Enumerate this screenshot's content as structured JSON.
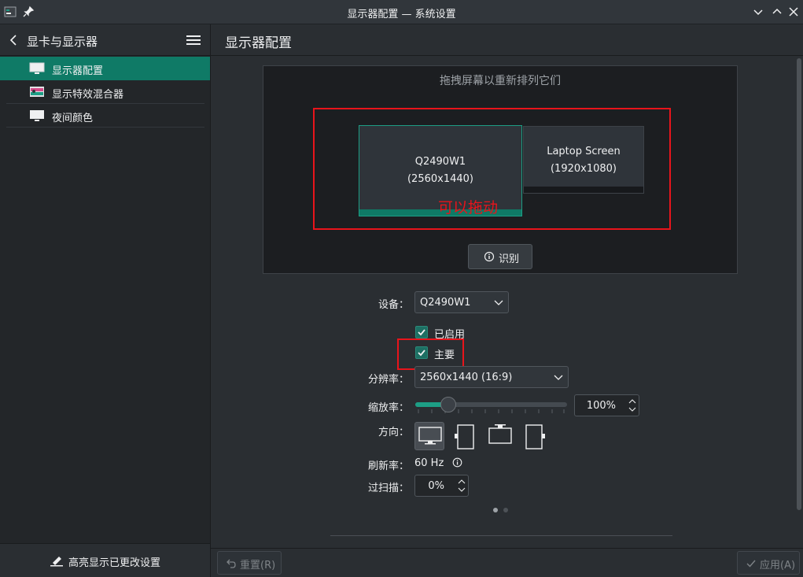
{
  "window": {
    "title": "显示器配置 — 系统设置"
  },
  "sidebar": {
    "title": "显卡与显示器",
    "items": [
      {
        "label": "显示器配置",
        "icon": "monitor-icon",
        "active": true
      },
      {
        "label": "显示特效混合器",
        "icon": "compositor-icon",
        "active": false
      },
      {
        "label": "夜间颜色",
        "icon": "night-color-icon",
        "active": false
      }
    ],
    "footer_label": "高亮显示已更改设置"
  },
  "main": {
    "title": "显示器配置",
    "arrange_hint": "拖拽屏幕以重新排列它们",
    "screens": [
      {
        "name": "Q2490W1",
        "resolution": "(2560x1440)"
      },
      {
        "name": "Laptop Screen",
        "resolution": "(1920x1080)"
      }
    ],
    "identify_label": "识别",
    "annotation_drag": "可以拖动",
    "device_label": "设备：",
    "device_value": "Q2490W1",
    "enabled_label": "已启用",
    "primary_label": "主要",
    "resolution_label": "分辨率：",
    "resolution_value": "2560x1440 (16:9)",
    "scale_label": "缩放率：",
    "scale_value": "100%",
    "scale_level": 0.22,
    "orientation_label": "方向：",
    "refresh_label": "刷新率：",
    "refresh_value": "60 Hz",
    "overscan_label": "过扫描：",
    "overscan_value": "0%"
  },
  "buttons": {
    "reset_label": "重置(R)",
    "apply_label": "应用(A)"
  },
  "colors": {
    "accent": "#0f7a66",
    "annotation": "#e8141b"
  }
}
